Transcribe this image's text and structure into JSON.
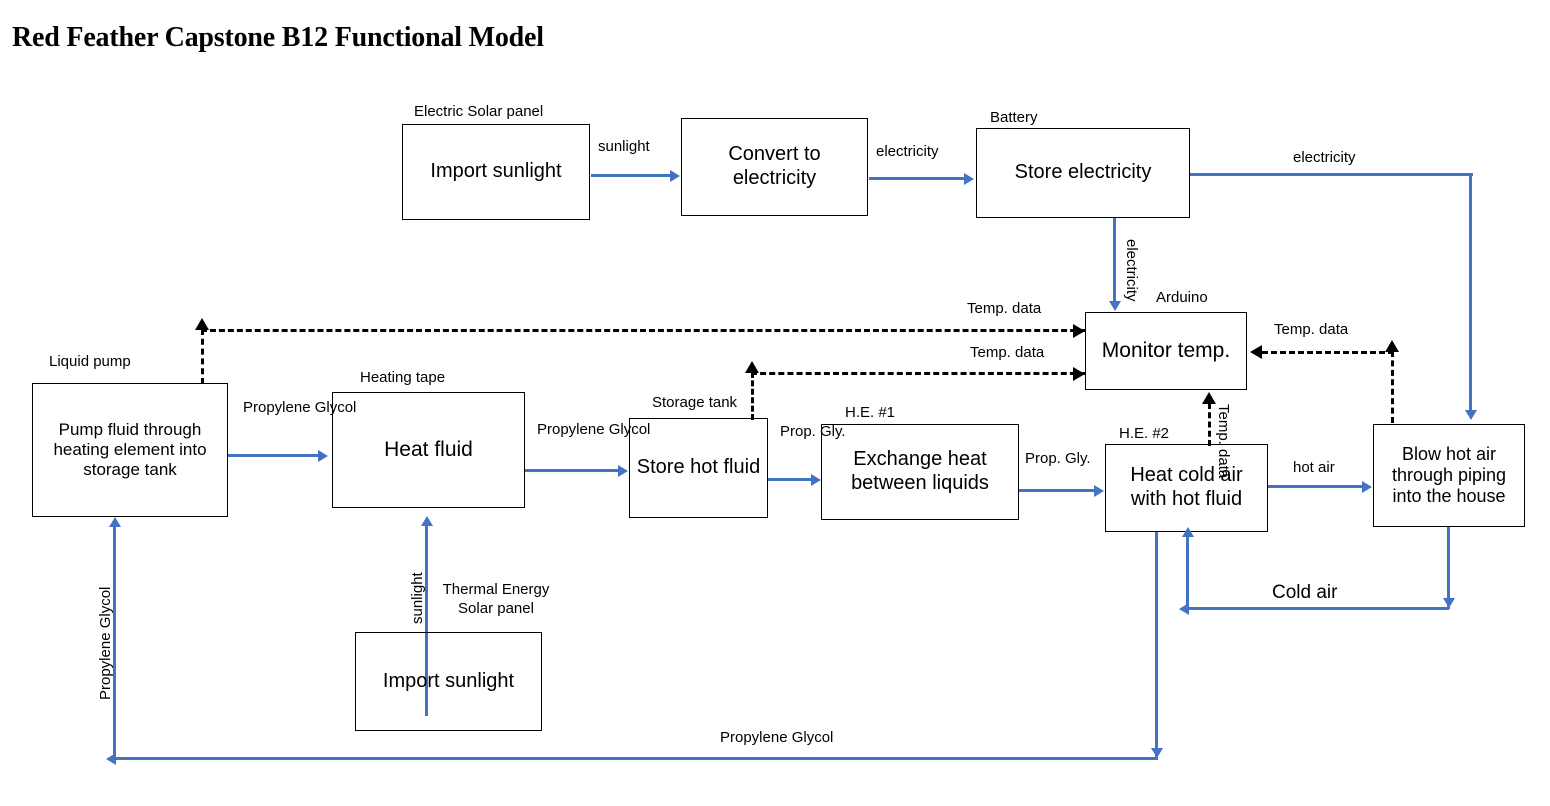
{
  "title": "Red Feather Capstone B12 Functional Model",
  "theme": {
    "flow_color": "#4472C4",
    "data_color": "#000000",
    "box_border": "#000000",
    "background": "#ffffff"
  },
  "boxes": [
    {
      "id": "electric_solar",
      "caption": "Electric Solar panel",
      "label": "Import sunlight"
    },
    {
      "id": "convert",
      "caption": "",
      "label": "Convert to electricity"
    },
    {
      "id": "battery",
      "caption": "Battery",
      "label": "Store electricity"
    },
    {
      "id": "pump",
      "caption": "Liquid pump",
      "label": "Pump fluid through heating element into storage tank"
    },
    {
      "id": "heating_tape",
      "caption": "Heating tape",
      "label": "Heat fluid"
    },
    {
      "id": "storage_tank",
      "caption": "Storage tank",
      "label": "Store hot fluid"
    },
    {
      "id": "he1",
      "caption": "H.E. #1",
      "label": "Exchange heat between liquids"
    },
    {
      "id": "he2",
      "caption": "H.E. #2",
      "label": "Heat cold air with hot fluid"
    },
    {
      "id": "arduino",
      "caption": "Arduino",
      "label": "Monitor temp."
    },
    {
      "id": "blower",
      "caption": "",
      "label": "Blow hot air through piping into the house"
    },
    {
      "id": "thermal_solar",
      "caption": "Thermal Energy Solar panel",
      "label": "Import sunlight"
    }
  ],
  "edges": {
    "sunlight_to_convert": "sunlight",
    "convert_to_battery": "electricity",
    "battery_to_blower": "electricity",
    "battery_to_arduino": "electricity",
    "pump_to_heat": "Propylene Glycol",
    "heat_to_storage": "Propylene Glycol",
    "storage_to_he1": "Prop. Gly.",
    "he1_to_he2": "Prop. Gly.",
    "he2_to_blower": "hot air",
    "blower_to_he2": "Cold air",
    "he2_to_pump": "Propylene Glycol",
    "pump_return_vertical": "Propylene Glycol",
    "thermal_sunlight": "sunlight",
    "arduino_to_pump": "Temp. data",
    "storage_to_arduino": "Temp. data",
    "blower_to_arduino": "Temp. data",
    "he2_to_arduino": "Temp. data"
  }
}
